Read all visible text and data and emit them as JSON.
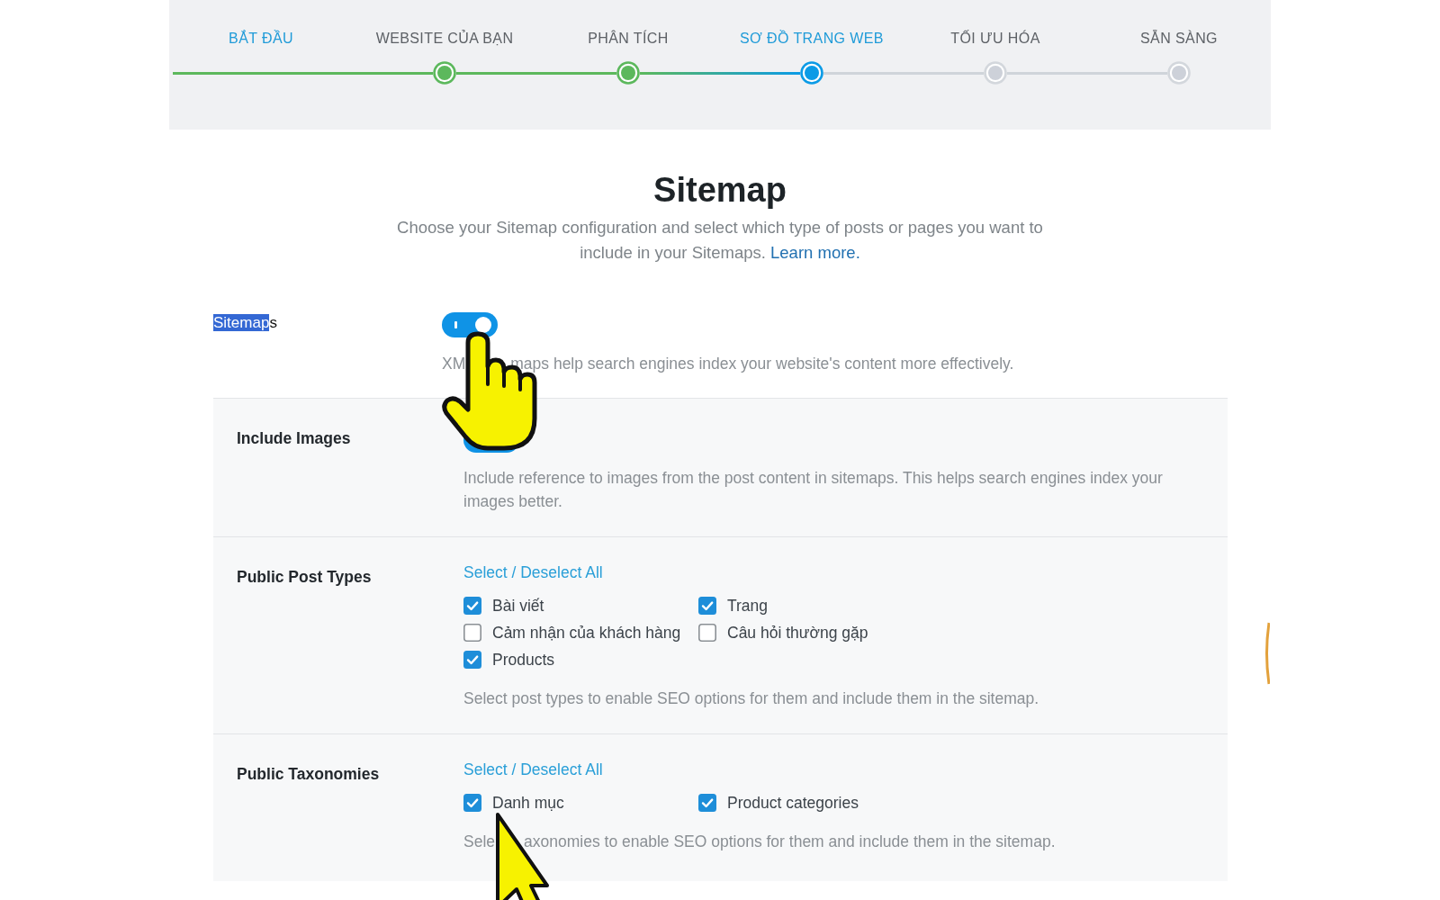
{
  "wizard_steps": [
    {
      "label": "BẮT ĐẦU",
      "kind": "start",
      "done": true,
      "selected": false
    },
    {
      "label": "WEBSITE CỦA BẠN",
      "kind": "step",
      "done": true,
      "selected": false
    },
    {
      "label": "PHÂN TÍCH",
      "kind": "step",
      "done": true,
      "selected": false
    },
    {
      "label": "SƠ ĐỒ TRANG WEB",
      "kind": "step",
      "done": false,
      "selected": true
    },
    {
      "label": "TỐI ƯU HÓA",
      "kind": "step",
      "done": false,
      "selected": false
    },
    {
      "label": "SẴN SÀNG",
      "kind": "step",
      "done": false,
      "selected": false
    }
  ],
  "heading": {
    "title": "Sitemap",
    "description": "Choose your Sitemap configuration and select which type of posts or pages you want to include in your Sitemaps.",
    "link": "Learn more."
  },
  "sitemaps": {
    "label_parts": [
      {
        "text": "Sitemap",
        "selected": true
      },
      {
        "text": "s",
        "selected": false
      }
    ],
    "on": true,
    "description_parts": [
      "XM",
      "maps help search engines index your website's content more effectively."
    ]
  },
  "settings": [
    {
      "kind": "toggle",
      "label": "Include Images",
      "on": true,
      "description_parts": [
        "Include reference to images from the post content in sitemaps. This helps search engines index your images better."
      ]
    },
    {
      "kind": "checklist",
      "label": "Public Post Types",
      "select_all": "Select / Deselect All",
      "options": [
        {
          "label": "Bài viết",
          "checked": true
        },
        {
          "label": "Trang",
          "checked": true
        },
        {
          "label": "Cảm nhận của khách hàng",
          "checked": false
        },
        {
          "label": "Câu hỏi thường gặp",
          "checked": false
        },
        {
          "label": "Products",
          "checked": true
        }
      ],
      "description_parts": [
        "Select post types to enable SEO options for them and include them in the sitemap."
      ]
    },
    {
      "kind": "checklist",
      "label": "Public Taxonomies",
      "select_all": "Select / Deselect All",
      "options": [
        {
          "label": "Danh mục",
          "checked": true
        },
        {
          "label": "Product categories",
          "checked": true
        }
      ],
      "description_parts": [
        "Sele",
        "axonomies to enable SEO options for them and include them in the sitemap."
      ]
    }
  ]
}
